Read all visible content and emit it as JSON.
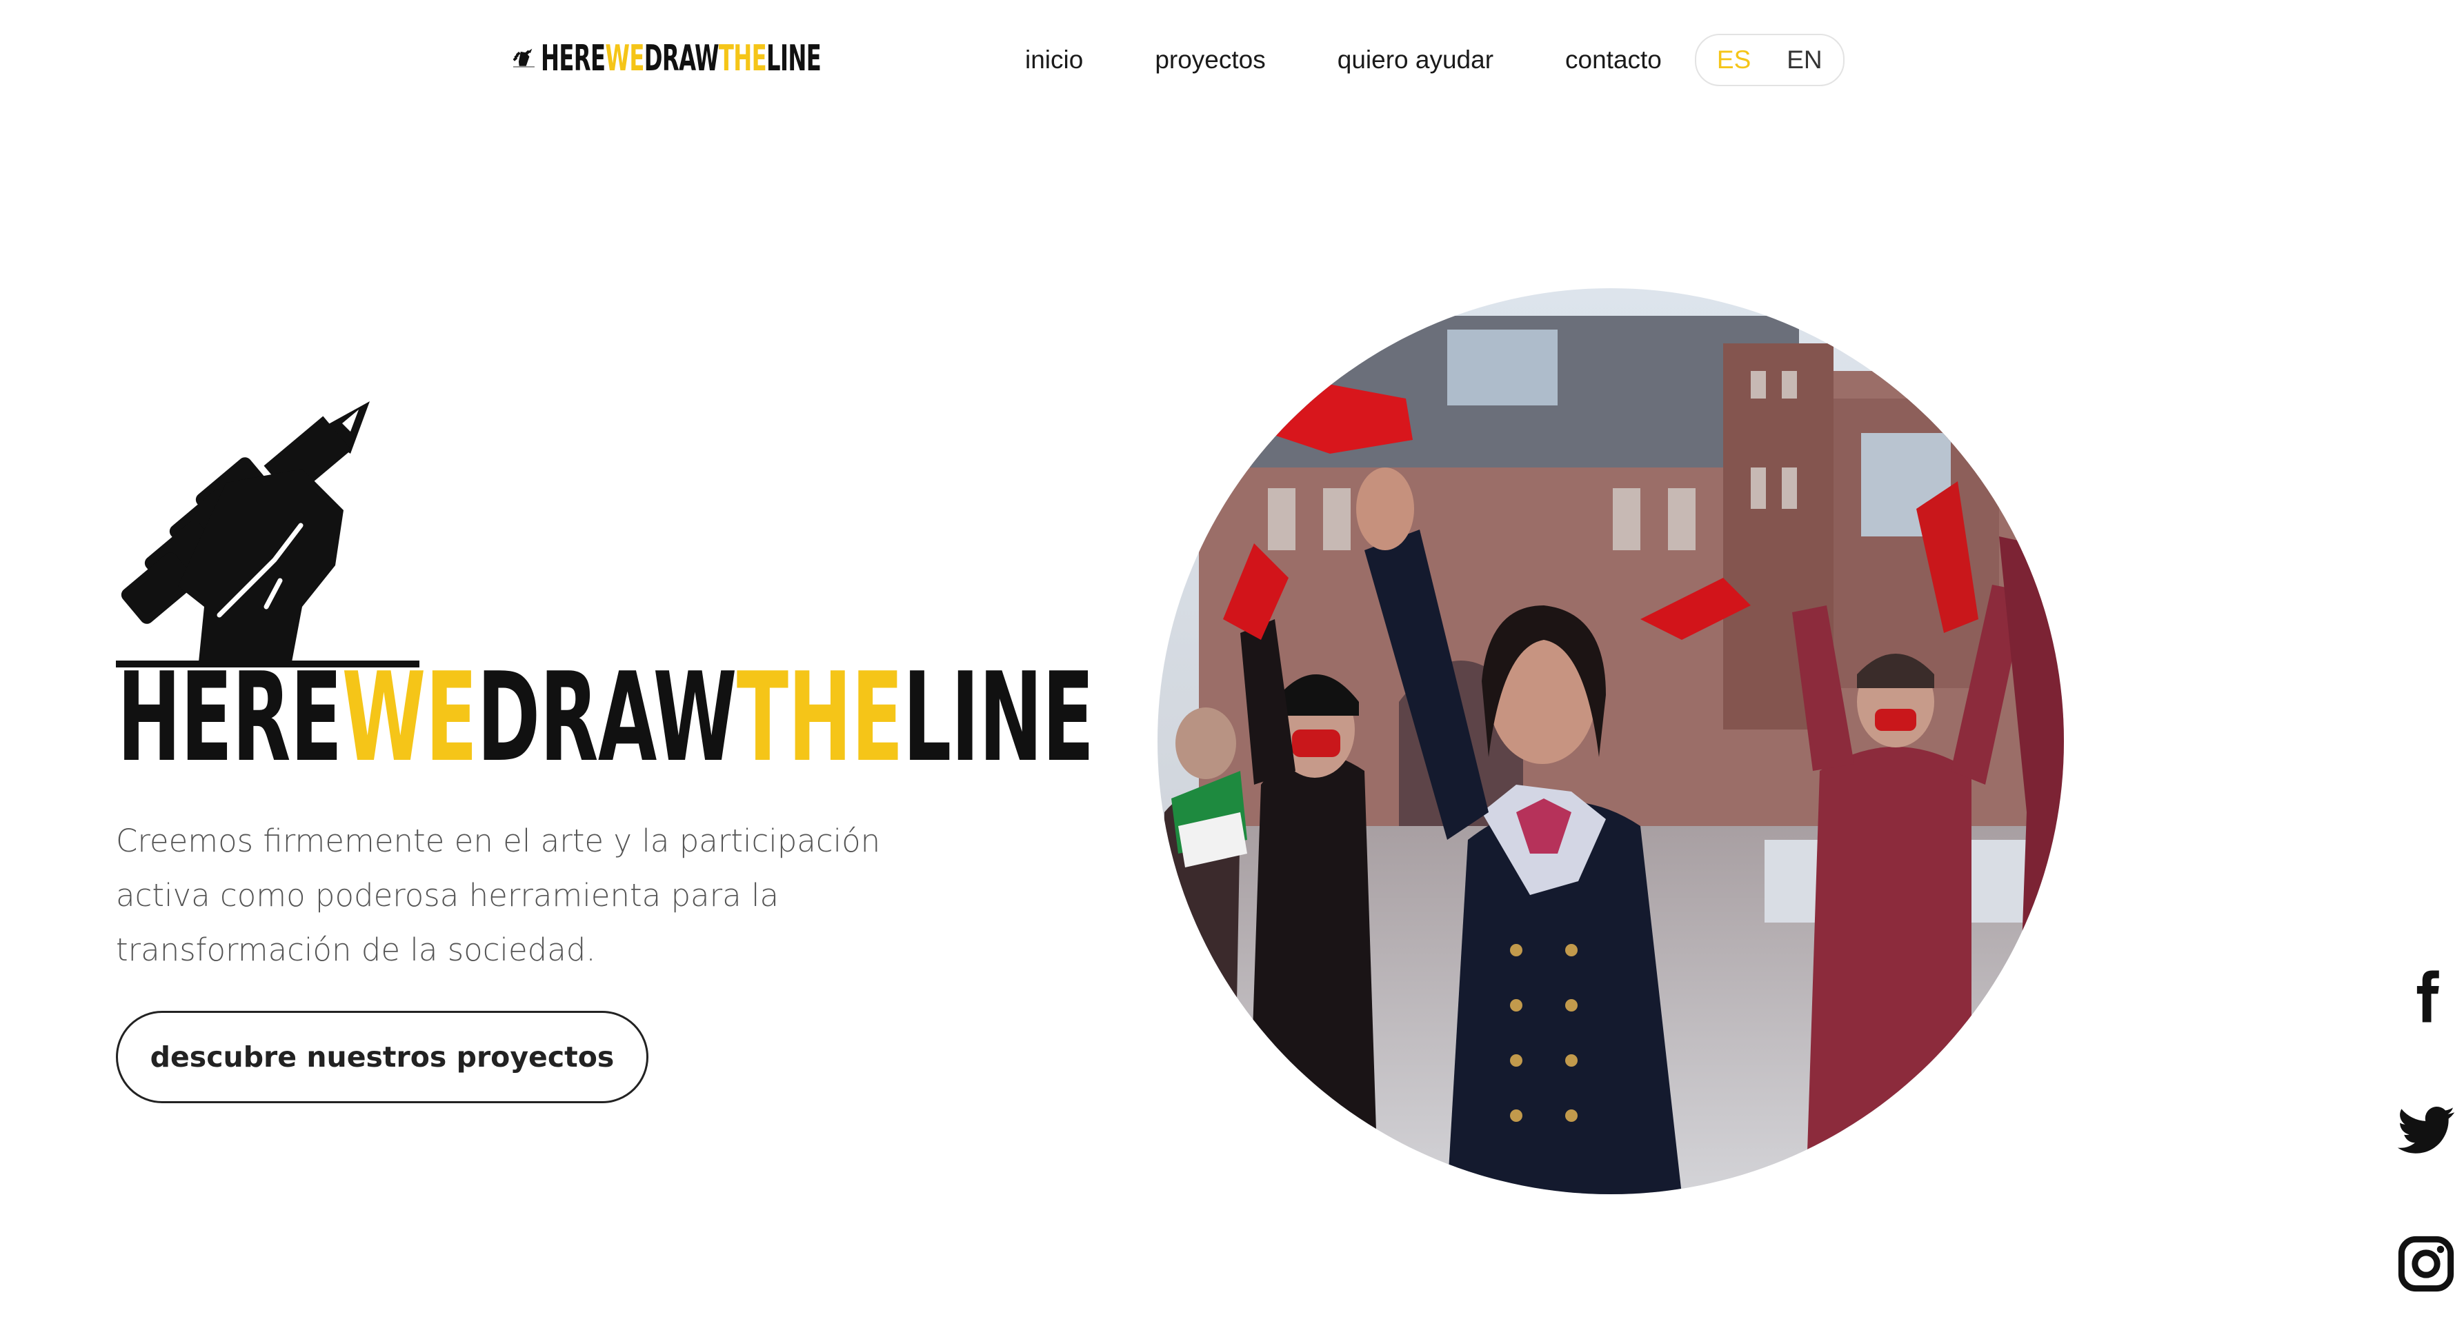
{
  "theme": {
    "accent": "#f5c518",
    "dark": "#111111"
  },
  "header": {
    "logo": {
      "parts": [
        "HERE",
        "WE",
        "DRAW",
        "THE",
        "LINE"
      ]
    },
    "nav": [
      {
        "label": "inicio"
      },
      {
        "label": "proyectos"
      },
      {
        "label": "quiero ayudar"
      },
      {
        "label": "contacto"
      }
    ],
    "languages": [
      {
        "label": "ES",
        "active": true
      },
      {
        "label": "EN",
        "active": false
      }
    ]
  },
  "hero": {
    "logo": {
      "parts": [
        "HERE",
        "WE",
        "DRAW",
        "THE",
        "LINE"
      ]
    },
    "description_lines": [
      "Creemos firmemente en el arte y la participación",
      "activa como poderosa herramienta para la",
      "transformación de la sociedad."
    ],
    "cta_label": "descubre nuestros proyectos"
  },
  "social": [
    {
      "icon": "facebook-icon"
    },
    {
      "icon": "twitter-icon"
    },
    {
      "icon": "instagram-icon"
    }
  ]
}
